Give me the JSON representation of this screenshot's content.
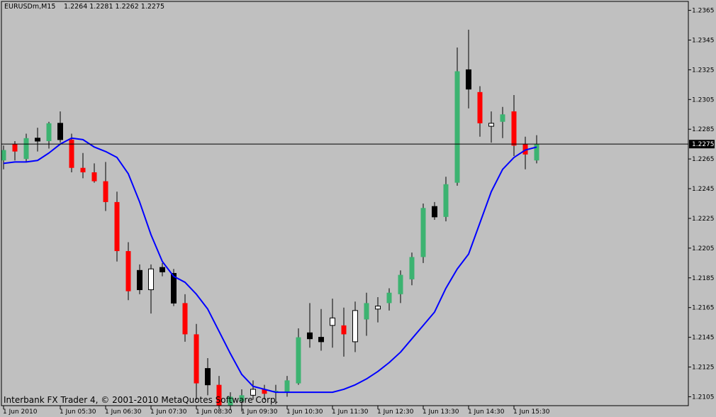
{
  "header": {
    "symbol": "EURUSDm,M15",
    "ohlc": "1.2264 1.2281 1.2262 1.2275"
  },
  "footer": {
    "copyright": "Interbank FX Trader 4, © 2001-2010 MetaQuotes Software Corp."
  },
  "colors": {
    "background": "#c0c0c0",
    "bull_body": "#3cb371",
    "bear_body": "#ff0000",
    "bull_body_alt": "#ffffff",
    "bear_body_alt": "#000000",
    "ma_line": "#0000ff",
    "price_line": "#000000"
  },
  "chart_data": {
    "type": "candlestick",
    "symbol": "EURUSDm",
    "timeframe": "M15",
    "y_ticks": [
      "1.2365",
      "1.2345",
      "1.2325",
      "1.2305",
      "1.2285",
      "1.2265",
      "1.2245",
      "1.2225",
      "1.2205",
      "1.2185",
      "1.2165",
      "1.2145",
      "1.2125",
      "1.2105"
    ],
    "ylim": [
      1.2099,
      1.2371
    ],
    "x_ticks": [
      {
        "label": "1 Jun 2010",
        "index": 0
      },
      {
        "label": "1 Jun 05:30",
        "index": 5
      },
      {
        "label": "1 Jun 06:30",
        "index": 9
      },
      {
        "label": "1 Jun 07:30",
        "index": 13
      },
      {
        "label": "1 Jun 08:30",
        "index": 17
      },
      {
        "label": "1 Jun 09:30",
        "index": 21
      },
      {
        "label": "1 Jun 10:30",
        "index": 25
      },
      {
        "label": "1 Jun 11:30",
        "index": 29
      },
      {
        "label": "1 Jun 12:30",
        "index": 33
      },
      {
        "label": "1 Jun 13:30",
        "index": 37
      },
      {
        "label": "1 Jun 14:30",
        "index": 41
      },
      {
        "label": "1 Jun 15:30",
        "index": 45
      }
    ],
    "current_price": 1.2275,
    "current_price_label": "1.2275",
    "candles": [
      {
        "o": 1.2264,
        "h": 1.2274,
        "l": 1.2258,
        "c": 1.2271,
        "s": "g"
      },
      {
        "o": 1.227,
        "h": 1.2277,
        "l": 1.2264,
        "c": 1.2275,
        "s": "r"
      },
      {
        "o": 1.2265,
        "h": 1.2282,
        "l": 1.2263,
        "c": 1.2279,
        "s": "g"
      },
      {
        "o": 1.2277,
        "h": 1.2286,
        "l": 1.227,
        "c": 1.2279,
        "s": "k"
      },
      {
        "o": 1.2277,
        "h": 1.229,
        "l": 1.2272,
        "c": 1.2289,
        "s": "g"
      },
      {
        "o": 1.2289,
        "h": 1.2297,
        "l": 1.2276,
        "c": 1.2278,
        "s": "k"
      },
      {
        "o": 1.2278,
        "h": 1.2282,
        "l": 1.2256,
        "c": 1.2259,
        "s": "r"
      },
      {
        "o": 1.2259,
        "h": 1.2269,
        "l": 1.2252,
        "c": 1.2256,
        "s": "r"
      },
      {
        "o": 1.2256,
        "h": 1.2262,
        "l": 1.2249,
        "c": 1.225,
        "s": "r"
      },
      {
        "o": 1.225,
        "h": 1.2263,
        "l": 1.223,
        "c": 1.2236,
        "s": "r"
      },
      {
        "o": 1.2236,
        "h": 1.2243,
        "l": 1.2196,
        "c": 1.2203,
        "s": "r"
      },
      {
        "o": 1.2203,
        "h": 1.2209,
        "l": 1.217,
        "c": 1.2176,
        "s": "r"
      },
      {
        "o": 1.219,
        "h": 1.2194,
        "l": 1.2174,
        "c": 1.2177,
        "s": "k"
      },
      {
        "o": 1.2177,
        "h": 1.2194,
        "l": 1.2161,
        "c": 1.2191,
        "s": "w"
      },
      {
        "o": 1.2192,
        "h": 1.2195,
        "l": 1.2186,
        "c": 1.2189,
        "s": "k"
      },
      {
        "o": 1.2188,
        "h": 1.2191,
        "l": 1.2166,
        "c": 1.2168,
        "s": "k"
      },
      {
        "o": 1.2168,
        "h": 1.2174,
        "l": 1.2142,
        "c": 1.2147,
        "s": "r"
      },
      {
        "o": 1.2147,
        "h": 1.2154,
        "l": 1.2103,
        "c": 1.2114,
        "s": "r"
      },
      {
        "o": 1.2124,
        "h": 1.2131,
        "l": 1.2106,
        "c": 1.2113,
        "s": "k"
      },
      {
        "o": 1.2113,
        "h": 1.2119,
        "l": 1.2097,
        "c": 1.2099,
        "s": "r"
      },
      {
        "o": 1.2099,
        "h": 1.2108,
        "l": 1.2096,
        "c": 1.2105,
        "s": "g"
      },
      {
        "o": 1.2102,
        "h": 1.211,
        "l": 1.2095,
        "c": 1.2106,
        "s": "g"
      },
      {
        "o": 1.2106,
        "h": 1.2116,
        "l": 1.2103,
        "c": 1.211,
        "s": "w"
      },
      {
        "o": 1.211,
        "h": 1.2113,
        "l": 1.2103,
        "c": 1.2107,
        "s": "r"
      },
      {
        "o": 1.2108,
        "h": 1.2113,
        "l": 1.21,
        "c": 1.2109,
        "s": "g"
      },
      {
        "o": 1.2108,
        "h": 1.2119,
        "l": 1.2105,
        "c": 1.2116,
        "s": "g"
      },
      {
        "o": 1.2114,
        "h": 1.2151,
        "l": 1.2113,
        "c": 1.2145,
        "s": "g"
      },
      {
        "o": 1.2144,
        "h": 1.2168,
        "l": 1.2138,
        "c": 1.2148,
        "s": "k"
      },
      {
        "o": 1.2142,
        "h": 1.2164,
        "l": 1.2136,
        "c": 1.2145,
        "s": "k"
      },
      {
        "o": 1.2153,
        "h": 1.2171,
        "l": 1.2138,
        "c": 1.2158,
        "s": "w"
      },
      {
        "o": 1.2153,
        "h": 1.2165,
        "l": 1.2132,
        "c": 1.2147,
        "s": "r"
      },
      {
        "o": 1.2142,
        "h": 1.2169,
        "l": 1.2135,
        "c": 1.2163,
        "s": "w"
      },
      {
        "o": 1.2157,
        "h": 1.2175,
        "l": 1.2146,
        "c": 1.2168,
        "s": "g"
      },
      {
        "o": 1.2164,
        "h": 1.2172,
        "l": 1.2155,
        "c": 1.2166,
        "s": "w"
      },
      {
        "o": 1.2168,
        "h": 1.2178,
        "l": 1.2163,
        "c": 1.2175,
        "s": "g"
      },
      {
        "o": 1.2174,
        "h": 1.219,
        "l": 1.2168,
        "c": 1.2187,
        "s": "g"
      },
      {
        "o": 1.2184,
        "h": 1.2202,
        "l": 1.218,
        "c": 1.2199,
        "s": "g"
      },
      {
        "o": 1.2199,
        "h": 1.2235,
        "l": 1.2195,
        "c": 1.2232,
        "s": "g"
      },
      {
        "o": 1.2233,
        "h": 1.2236,
        "l": 1.2224,
        "c": 1.2226,
        "s": "k"
      },
      {
        "o": 1.2226,
        "h": 1.2253,
        "l": 1.2223,
        "c": 1.2248,
        "s": "g"
      },
      {
        "o": 1.2249,
        "h": 1.234,
        "l": 1.2247,
        "c": 1.2324,
        "s": "g"
      },
      {
        "o": 1.2325,
        "h": 1.2352,
        "l": 1.2299,
        "c": 1.2312,
        "s": "k"
      },
      {
        "o": 1.231,
        "h": 1.2314,
        "l": 1.228,
        "c": 1.2289,
        "s": "r"
      },
      {
        "o": 1.2287,
        "h": 1.2297,
        "l": 1.2276,
        "c": 1.2289,
        "s": "w"
      },
      {
        "o": 1.229,
        "h": 1.23,
        "l": 1.2279,
        "c": 1.2295,
        "s": "g"
      },
      {
        "o": 1.2297,
        "h": 1.2308,
        "l": 1.2267,
        "c": 1.2274,
        "s": "r"
      },
      {
        "o": 1.2275,
        "h": 1.228,
        "l": 1.2258,
        "c": 1.2268,
        "s": "r"
      },
      {
        "o": 1.2264,
        "h": 1.2281,
        "l": 1.2262,
        "c": 1.2275,
        "s": "g"
      }
    ],
    "moving_average": [
      1.2262,
      1.2263,
      1.2263,
      1.2264,
      1.2269,
      1.2275,
      1.2279,
      1.2278,
      1.2273,
      1.227,
      1.2266,
      1.2255,
      1.2236,
      1.2214,
      1.2196,
      1.2186,
      1.2182,
      1.2174,
      1.2164,
      1.2149,
      1.2134,
      1.212,
      1.2112,
      1.211,
      1.2108,
      1.2108,
      1.2108,
      1.2108,
      1.2108,
      1.2108,
      1.211,
      1.2113,
      1.2117,
      1.2122,
      1.2128,
      1.2135,
      1.2144,
      1.2153,
      1.2162,
      1.2178,
      1.2191,
      1.2201,
      1.2222,
      1.2243,
      1.2258,
      1.2266,
      1.2271,
      1.2273
    ]
  }
}
